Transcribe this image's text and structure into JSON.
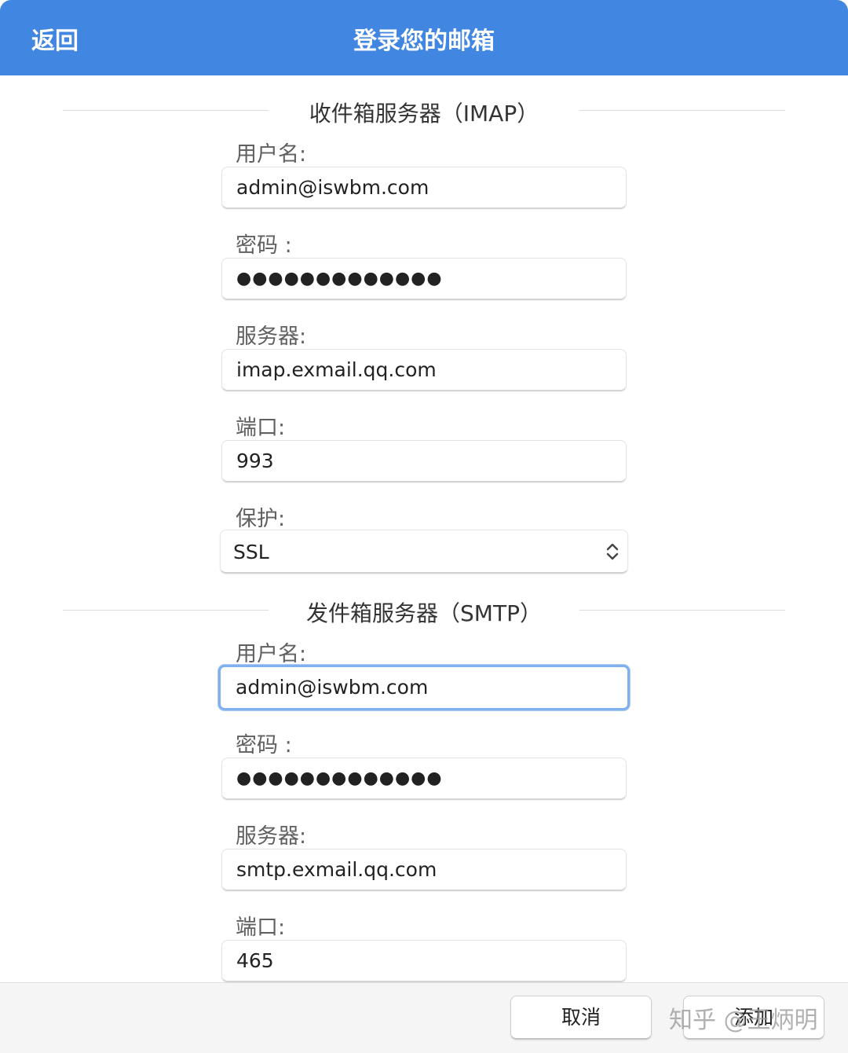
{
  "header": {
    "back_label": "返回",
    "title": "登录您的邮箱"
  },
  "imap": {
    "section_title": "收件箱服务器（IMAP）",
    "username_label": "用户名:",
    "username_value": "admin@iswbm.com",
    "password_label": "密码 :",
    "password_value": "●●●●●●●●●●●●●",
    "server_label": "服务器:",
    "server_value": "imap.exmail.qq.com",
    "port_label": "端口:",
    "port_value": "993",
    "protection_label": "保护:",
    "protection_value": "SSL"
  },
  "smtp": {
    "section_title": "发件箱服务器（SMTP）",
    "username_label": "用户名:",
    "username_value": "admin@iswbm.com",
    "password_label": "密码 :",
    "password_value": "●●●●●●●●●●●●●",
    "server_label": "服务器:",
    "server_value": "smtp.exmail.qq.com",
    "port_label": "端口:",
    "port_value": "465"
  },
  "footer": {
    "cancel_label": "取消",
    "add_label": "添加",
    "watermark": "知乎 @王炳明"
  },
  "colors": {
    "header_bg": "#4186e0",
    "focus_ring": "#7fb1ee"
  }
}
